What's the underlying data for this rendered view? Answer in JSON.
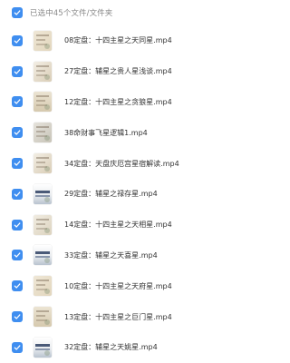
{
  "header": {
    "selection_label": "已选中45个文件/文件夹"
  },
  "colors": {
    "accent": "#3f8ef0",
    "text": "#333333",
    "muted": "#888888"
  },
  "files": [
    {
      "name": "08定盘：十四主星之天同星.mp4",
      "thumb": "style-a"
    },
    {
      "name": "27定盘：辅星之贵人星浅谈.mp4",
      "thumb": "style-b"
    },
    {
      "name": "12定盘：十四主星之贪狼星.mp4",
      "thumb": "style-c"
    },
    {
      "name": "38命财事飞星逻辑1.mp4",
      "thumb": "style-d"
    },
    {
      "name": "34定盘：天盘庆厄宫星宿解读.mp4",
      "thumb": "style-b"
    },
    {
      "name": "29定盘：辅星之禄存星.mp4",
      "thumb": "style-e"
    },
    {
      "name": "14定盘：十四主星之天相星.mp4",
      "thumb": "style-f"
    },
    {
      "name": "33定盘：辅星之天喜星.mp4",
      "thumb": "style-e"
    },
    {
      "name": "10定盘：十四主星之天府星.mp4",
      "thumb": "style-a"
    },
    {
      "name": "13定盘：十四主星之巨门星.mp4",
      "thumb": "style-c"
    },
    {
      "name": "32定盘：辅星之天姚星.mp4",
      "thumb": "style-e"
    }
  ]
}
